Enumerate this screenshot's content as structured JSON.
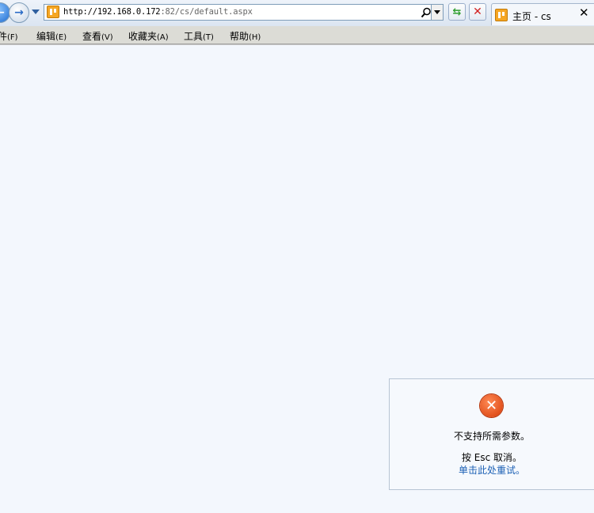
{
  "toolbar": {
    "back_icon": "back-arrow-icon",
    "forward_icon": "forward-arrow-icon",
    "address": {
      "host": "http://192.168.0.172",
      "rest": ":82/cs/default.aspx"
    },
    "refresh_icon": "refresh-icon",
    "stop_icon": "stop-icon"
  },
  "tab": {
    "title": "主页 - cs",
    "close_label": "✕"
  },
  "menu": [
    {
      "label": "件",
      "accel": "(F)"
    },
    {
      "label": "编辑",
      "accel": "(E)"
    },
    {
      "label": "查看",
      "accel": "(V)"
    },
    {
      "label": "收藏夹",
      "accel": "(A)"
    },
    {
      "label": "工具",
      "accel": "(T)"
    },
    {
      "label": "帮助",
      "accel": "(H)"
    }
  ],
  "error": {
    "icon": "error-x-icon",
    "message": "不支持所需参数。",
    "esc_text": "按 Esc 取消。",
    "retry_text": "单击此处重试。"
  },
  "colors": {
    "content_bg": "#f3f7fd",
    "link": "#1a5fb4",
    "error_icon": "#d53a06"
  }
}
